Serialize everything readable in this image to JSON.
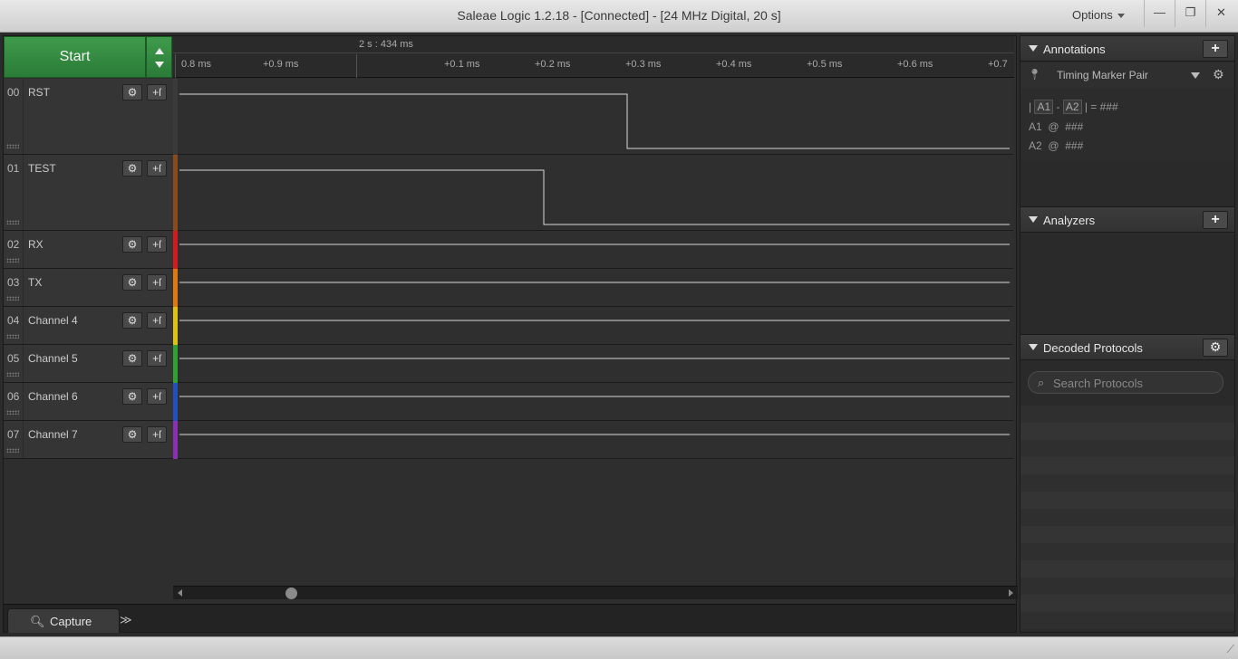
{
  "window": {
    "title": "Saleae Logic 1.2.18 - [Connected] - [24 MHz Digital, 20 s]",
    "options_label": "Options",
    "minimize_label": "—",
    "restore_label": "❐",
    "close_label": "✕"
  },
  "capture": {
    "start_label": "Start",
    "absolute_time": "2 s : 434 ms",
    "ticks": [
      "0.8 ms",
      "+0.9 ms",
      "+0.1 ms",
      "+0.2 ms",
      "+0.3 ms",
      "+0.4 ms",
      "+0.5 ms",
      "+0.6 ms",
      "+0.7"
    ]
  },
  "channels": [
    {
      "num": "00",
      "name": "RST",
      "color": "#3a3a3a"
    },
    {
      "num": "01",
      "name": "TEST",
      "color": "#8a4a1a"
    },
    {
      "num": "02",
      "name": "RX",
      "color": "#d01c1c"
    },
    {
      "num": "03",
      "name": "TX",
      "color": "#e07810"
    },
    {
      "num": "04",
      "name": "Channel 4",
      "color": "#e0c010"
    },
    {
      "num": "05",
      "name": "Channel 5",
      "color": "#30a030"
    },
    {
      "num": "06",
      "name": "Channel 6",
      "color": "#2050c0"
    },
    {
      "num": "07",
      "name": "Channel 7",
      "color": "#8a30b0"
    }
  ],
  "channel_icons": {
    "settings": "gear-icon",
    "trigger": "trigger-edge-icon"
  },
  "tabs": {
    "capture_label": "Capture",
    "more_label": "≫"
  },
  "annotations": {
    "header": "Annotations",
    "add_label": "+",
    "marker_label": "Timing Marker Pair",
    "formula_a1": "A1",
    "formula_a2": "A2",
    "formula_result": "###",
    "a1_label": "A1",
    "a2_label": "A2",
    "at": "@",
    "a1_value": "###",
    "a2_value": "###"
  },
  "analyzers": {
    "header": "Analyzers",
    "add_label": "+"
  },
  "decoded": {
    "header": "Decoded Protocols",
    "search_placeholder": "Search Protocols"
  }
}
